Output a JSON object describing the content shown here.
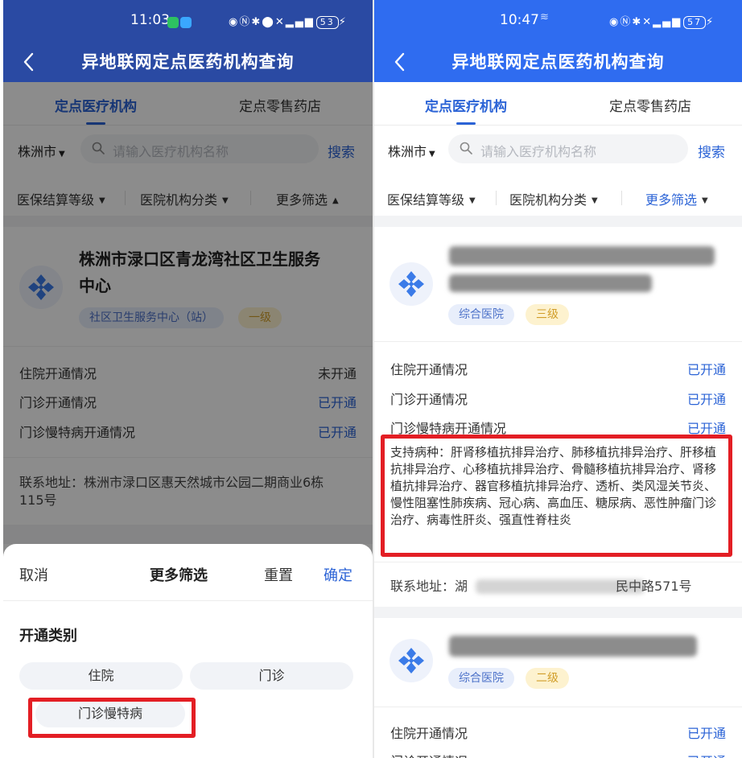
{
  "colors": {
    "brand_blue": "#2b63d6",
    "header_left": "#2a4aa3",
    "header_right": "#2f6cf0",
    "highlight_red": "#e31e24"
  },
  "left": {
    "status": {
      "time": "11:03",
      "battery": "53"
    },
    "nav": {
      "title": "异地联网定点医药机构查询"
    },
    "tabs": [
      "定点医疗机构",
      "定点零售药店"
    ],
    "search": {
      "city": "株洲市",
      "placeholder": "请输入医疗机构名称",
      "button": "搜索"
    },
    "filters": [
      "医保结算等级",
      "医院机构分类",
      "更多筛选"
    ],
    "card": {
      "name_line1": "株洲市渌口区青龙湾社区卫生服务",
      "name_line2": "中心",
      "type_tag": "社区卫生服务中心（站）",
      "level_tag": "一级",
      "rows": [
        {
          "label": "住院开通情况",
          "value": "未开通"
        },
        {
          "label": "门诊开通情况",
          "value": "已开通"
        },
        {
          "label": "门诊慢特病开通情况",
          "value": "已开通"
        }
      ],
      "address_line1": "联系地址：株洲市渌口区惠天然城市公园二期商业6栋",
      "address_line2": "115号"
    },
    "sheet": {
      "cancel": "取消",
      "title": "更多筛选",
      "reset": "重置",
      "confirm": "确定",
      "section": "开通类别",
      "options": [
        "住院",
        "门诊",
        "门诊慢特病"
      ]
    }
  },
  "right": {
    "status": {
      "time": "10:47",
      "battery": "57"
    },
    "nav": {
      "title": "异地联网定点医药机构查询"
    },
    "tabs": [
      "定点医疗机构",
      "定点零售药店"
    ],
    "search": {
      "city": "株洲市",
      "placeholder": "请输入医疗机构名称",
      "button": "搜索"
    },
    "filters": [
      "医保结算等级",
      "医院机构分类",
      "更多筛选"
    ],
    "card1": {
      "type_tag": "综合医院",
      "level_tag": "三级",
      "rows": [
        {
          "label": "住院开通情况",
          "value": "已开通"
        },
        {
          "label": "门诊开通情况",
          "value": "已开通"
        },
        {
          "label": "门诊慢特病开通情况",
          "value": "已开通"
        }
      ],
      "diseases": "支持病种：肝肾移植抗排异治疗、肺移植抗排异治疗、肝移植抗排异治疗、心移植抗排异治疗、骨髓移植抗排异治疗、肾移植抗排异治疗、器官移植抗排异治疗、透析、类风湿关节炎、慢性阻塞性肺疾病、冠心病、高血压、糖尿病、恶性肿瘤门诊治疗、病毒性肝炎、强直性脊柱炎",
      "address_prefix": "联系地址：湖",
      "address_suffix": "民中路571号"
    },
    "card2": {
      "type_tag": "综合医院",
      "level_tag": "二级",
      "rows": [
        {
          "label": "住院开通情况",
          "value": "已开通"
        },
        {
          "label": "门诊开通情况",
          "value": "已开通"
        }
      ]
    }
  }
}
